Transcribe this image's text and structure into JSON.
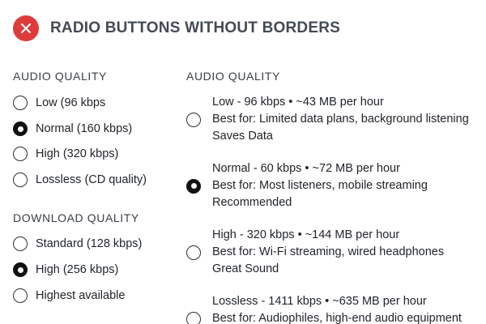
{
  "header": {
    "title": "RADIO BUTTONS WITHOUT BORDERS",
    "icon": "close-icon",
    "icon_color": "#e03b3b"
  },
  "left": {
    "audio_section_label": "AUDIO QUALITY",
    "audio_options": [
      {
        "label": "Low (96 kbps",
        "checked": false
      },
      {
        "label": "Normal (160 kbps)",
        "checked": true
      },
      {
        "label": "High (320 kbps)",
        "checked": false
      },
      {
        "label": "Lossless (CD quality)",
        "checked": false
      }
    ],
    "download_section_label": "DOWNLOAD QUALITY",
    "download_options": [
      {
        "label": "Standard (128 kbps)",
        "checked": false
      },
      {
        "label": "High (256 kbps)",
        "checked": true
      },
      {
        "label": "Highest available",
        "checked": false
      }
    ]
  },
  "right": {
    "section_label": "AUDIO QUALITY",
    "options": [
      {
        "title": "Low - 96 kbps • ~43 MB per hour",
        "best_for": "Best for: Limited data plans, background listening",
        "note": "Saves Data",
        "checked": false
      },
      {
        "title": "Normal - 60 kbps • ~72 MB per hour",
        "best_for": "Best for: Most listeners, mobile streaming",
        "note": "Recommended",
        "checked": true
      },
      {
        "title": "High - 320 kbps • ~144 MB per hour",
        "best_for": "Best for: Wi-Fi streaming, wired headphones",
        "note": "Great Sound",
        "checked": false
      },
      {
        "title": "Lossless - 1411 kbps • ~635 MB per hour",
        "best_for": "Best for: Audiophiles, high-end audio equipment",
        "note": "",
        "checked": false
      }
    ]
  }
}
